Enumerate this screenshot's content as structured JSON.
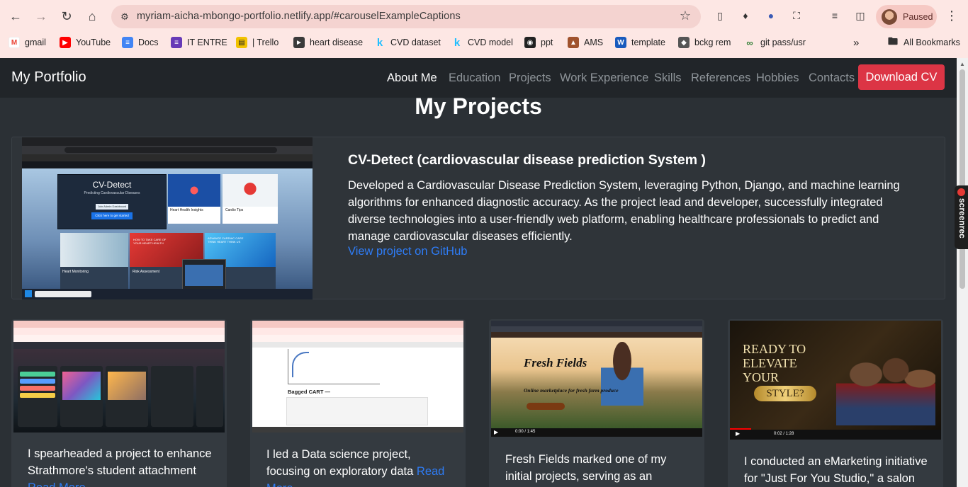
{
  "browser": {
    "url": "myriam-aicha-mbongo-portfolio.netlify.app/#carouselExampleCaptions",
    "profile_label": "Paused",
    "bookmarks": [
      {
        "label": "gmail",
        "icon": "gmail-icon",
        "color": "#ea4335"
      },
      {
        "label": "YouTube",
        "icon": "youtube-icon",
        "color": "#ff0000"
      },
      {
        "label": "Docs",
        "icon": "docs-icon",
        "color": "#4285f4"
      },
      {
        "label": "IT ENTRE",
        "icon": "forms-icon",
        "color": "#673ab7"
      },
      {
        "label": "| Trello",
        "icon": "trello-icon",
        "color": "#f2c200"
      },
      {
        "label": "heart disease",
        "icon": "kaggle-flag-icon",
        "color": "#3a3a3a"
      },
      {
        "label": "CVD dataset",
        "icon": "kaggle-icon",
        "color": "#20beff"
      },
      {
        "label": "CVD model",
        "icon": "kaggle-icon",
        "color": "#20beff"
      },
      {
        "label": "ppt",
        "icon": "github-icon",
        "color": "#222222"
      },
      {
        "label": "AMS",
        "icon": "crest-icon",
        "color": "#a0522d"
      },
      {
        "label": "template",
        "icon": "word-icon",
        "color": "#185abd"
      },
      {
        "label": "bckg rem",
        "icon": "hat-icon",
        "color": "#444444"
      },
      {
        "label": "git pass/usr",
        "icon": "link-icon",
        "color": "#2e7d32"
      }
    ],
    "all_bookmarks_label": "All Bookmarks"
  },
  "navbar": {
    "brand": "My Portfolio",
    "links": [
      "About Me",
      "Education",
      "Projects",
      "Work Experience",
      "Skills",
      "References",
      "Hobbies",
      "Contacts"
    ],
    "active_index": 0,
    "download_label": "Download CV"
  },
  "projects": {
    "title": "My Projects",
    "featured": {
      "title": "CV-Detect (cardiovascular disease prediction System )",
      "description": "Developed a Cardiovascular Disease Prediction System, leveraging Python, Django, and machine learning algorithms for enhanced diagnostic accuracy. As the project lead and developer, successfully integrated diverse technologies into a user-friendly web platform, enabling healthcare professionals to predict and manage cardiovascular diseases efficiently.",
      "link": "View project on GitHub",
      "thumb": {
        "app_title": "CV-Detect",
        "app_sub": "Predicting Cardiovascular Diseases",
        "btn1": "Join Admin Dashboard",
        "btn2": "Click here to get started",
        "tile1": "Heart Health Insights",
        "tile2": "Cardio Tips",
        "tile3": "Heart Monitoring",
        "tile4": "Risk Assessment",
        "promo1": "HOW TO TAKE CARE OF YOUR HEART HEALTH",
        "promo2": "ADVANCE CARDIAC CARE THINK HEART THINK US"
      }
    },
    "cards": [
      {
        "text": "I spearheaded a project to enhance Strathmore's student attachment",
        "more": "Read More"
      },
      {
        "text": "I led a Data science project, focusing on exploratory data",
        "more": "Read More"
      },
      {
        "text": "Fresh Fields marked one of my initial projects, serving as an",
        "more": ""
      },
      {
        "text": "I conducted an eMarketing initiative for \"Just For You Studio,\" a salon",
        "more": ""
      }
    ],
    "card_thumbs": {
      "c2_heading": "Bagged CART —",
      "c3_title": "Fresh Fields",
      "c3_sub": "Online marketplace for fresh farm produce",
      "c3_time": "0:00 / 1:45",
      "c4_line1": "READY TO",
      "c4_line2": "ELEVATE",
      "c4_line3": "YOUR",
      "c4_line4": "STYLE?",
      "c4_time": "0:02 / 1:28"
    }
  },
  "screenrec_label": "screenrec"
}
